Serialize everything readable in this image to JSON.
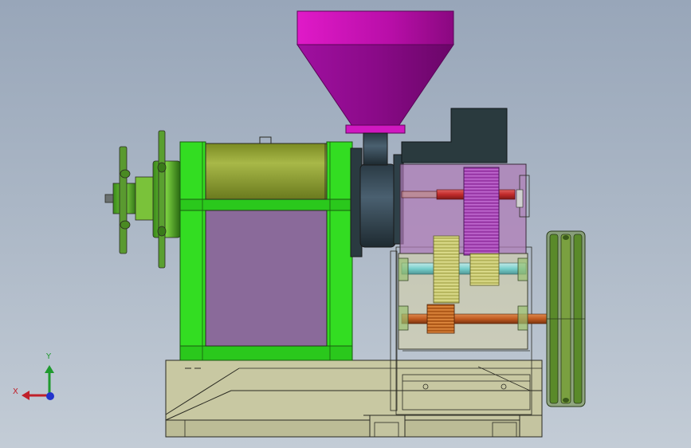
{
  "view": {
    "background_top": "#98a6b9",
    "background_bottom": "#c3ccd6"
  },
  "triad": {
    "x_label": "X",
    "y_label": "Y",
    "x_color": "#c0202a",
    "y_color": "#1f9a2e",
    "z_color": "#2233cc"
  },
  "parts": [
    {
      "name": "feed-hopper",
      "color": "#c010b0"
    },
    {
      "name": "press-barrel",
      "color": "#8a9a2a"
    },
    {
      "name": "barrel-frame",
      "color": "#33dd22"
    },
    {
      "name": "inspection-panel",
      "color": "#8a6a9a"
    },
    {
      "name": "gearbox-housing",
      "color": "#b07ab8"
    },
    {
      "name": "motor-cover",
      "color": "#2a3a3e"
    },
    {
      "name": "drive-pulley",
      "color": "#5a8a2a"
    },
    {
      "name": "base-frame",
      "color": "#c8c8a2"
    }
  ]
}
